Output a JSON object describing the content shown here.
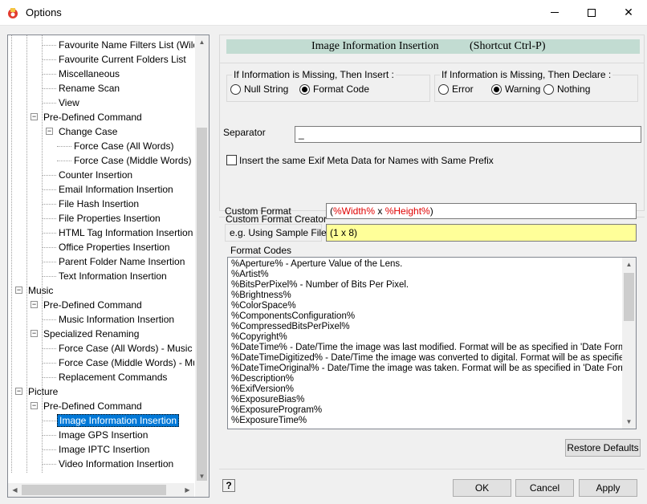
{
  "window": {
    "title": "Options",
    "minimize_label": "",
    "maximize_label": "",
    "close_label": "✕"
  },
  "tree": {
    "items": [
      {
        "label": "Favourite Name Filters List (Wildcard",
        "level": 2
      },
      {
        "label": "Favourite Current Folders List",
        "level": 2
      },
      {
        "label": "Miscellaneous",
        "level": 2
      },
      {
        "label": "Rename Scan",
        "level": 2
      },
      {
        "label": "View",
        "level": 2
      },
      {
        "label": "Pre-Defined Command",
        "level": 1
      },
      {
        "label": "Change Case",
        "level": 2
      },
      {
        "label": "Force Case (All Words)",
        "level": 3
      },
      {
        "label": "Force Case (Middle Words)",
        "level": 3
      },
      {
        "label": "Counter Insertion",
        "level": 2
      },
      {
        "label": "Email Information Insertion",
        "level": 2
      },
      {
        "label": "File Hash Insertion",
        "level": 2
      },
      {
        "label": "File Properties Insertion",
        "level": 2
      },
      {
        "label": "HTML Tag Information Insertion",
        "level": 2
      },
      {
        "label": "Office Properties Insertion",
        "level": 2
      },
      {
        "label": "Parent Folder Name Insertion",
        "level": 2
      },
      {
        "label": "Text Information Insertion",
        "level": 2
      },
      {
        "label": "Music",
        "level": 0
      },
      {
        "label": "Pre-Defined Command",
        "level": 1
      },
      {
        "label": "Music Information Insertion",
        "level": 2
      },
      {
        "label": "Specialized Renaming",
        "level": 1
      },
      {
        "label": "Force Case (All Words) - Music",
        "level": 2
      },
      {
        "label": "Force Case (Middle Words) - Mu",
        "level": 2
      },
      {
        "label": "Replacement Commands",
        "level": 2
      },
      {
        "label": "Picture",
        "level": 0
      },
      {
        "label": "Pre-Defined Command",
        "level": 1
      },
      {
        "label": "Image Information Insertion",
        "level": 2
      },
      {
        "label": "Image GPS Insertion",
        "level": 2
      },
      {
        "label": "Image IPTC Insertion",
        "level": 2
      },
      {
        "label": "Video Information Insertion",
        "level": 2
      }
    ],
    "selected_index": 26
  },
  "header": {
    "title": "Image Information Insertion",
    "shortcut": "(Shortcut Ctrl-P)"
  },
  "missing_insert": {
    "title": "If Information is Missing, Then Insert :",
    "options": [
      "Null String",
      "Format Code"
    ],
    "selected": 1
  },
  "missing_declare": {
    "title": "If Information is Missing, Then Declare :",
    "options": [
      "Error",
      "Warning",
      "Nothing"
    ],
    "selected": 1
  },
  "separator": {
    "label": "Separator",
    "value": "_"
  },
  "same_prefix": {
    "label": "Insert the same Exif Meta Data for Names with Same Prefix",
    "checked": false
  },
  "custom_format_creator": {
    "title": "Custom Format Creator",
    "custom_format_label": "Custom Format",
    "custom_format_parts": [
      "(",
      "%Width%",
      " x ",
      "%Height%",
      ")"
    ],
    "sample_label": "e.g. Using Sample File:",
    "sample_value": "(1 x 8)",
    "format_codes_title": "Format Codes",
    "codes": [
      "%Aperture%   - Aperture Value of the Lens.",
      "%Artist%",
      "%BitsPerPixel%   - Number of Bits Per Pixel.",
      "%Brightness%",
      "%ColorSpace%",
      "%ComponentsConfiguration%",
      "%CompressedBitsPerPixel%",
      "%Copyright%",
      "%DateTime%   - Date/Time the image was last modified.  Format will be as specified in 'Date Formatte",
      "%DateTimeDigitized%   - Date/Time the image was converted to digital.  Format will be as specified in",
      "%DateTimeOriginal%   - Date/Time the image was taken.  Format will be as specified in 'Date Formatte",
      "%Description%",
      "%ExifVersion%",
      "%ExposureBias%",
      "%ExposureProgram%",
      "%ExposureTime%"
    ]
  },
  "buttons": {
    "restore_defaults": "Restore Defaults",
    "help": "?",
    "ok": "OK",
    "cancel": "Cancel",
    "apply": "Apply"
  }
}
